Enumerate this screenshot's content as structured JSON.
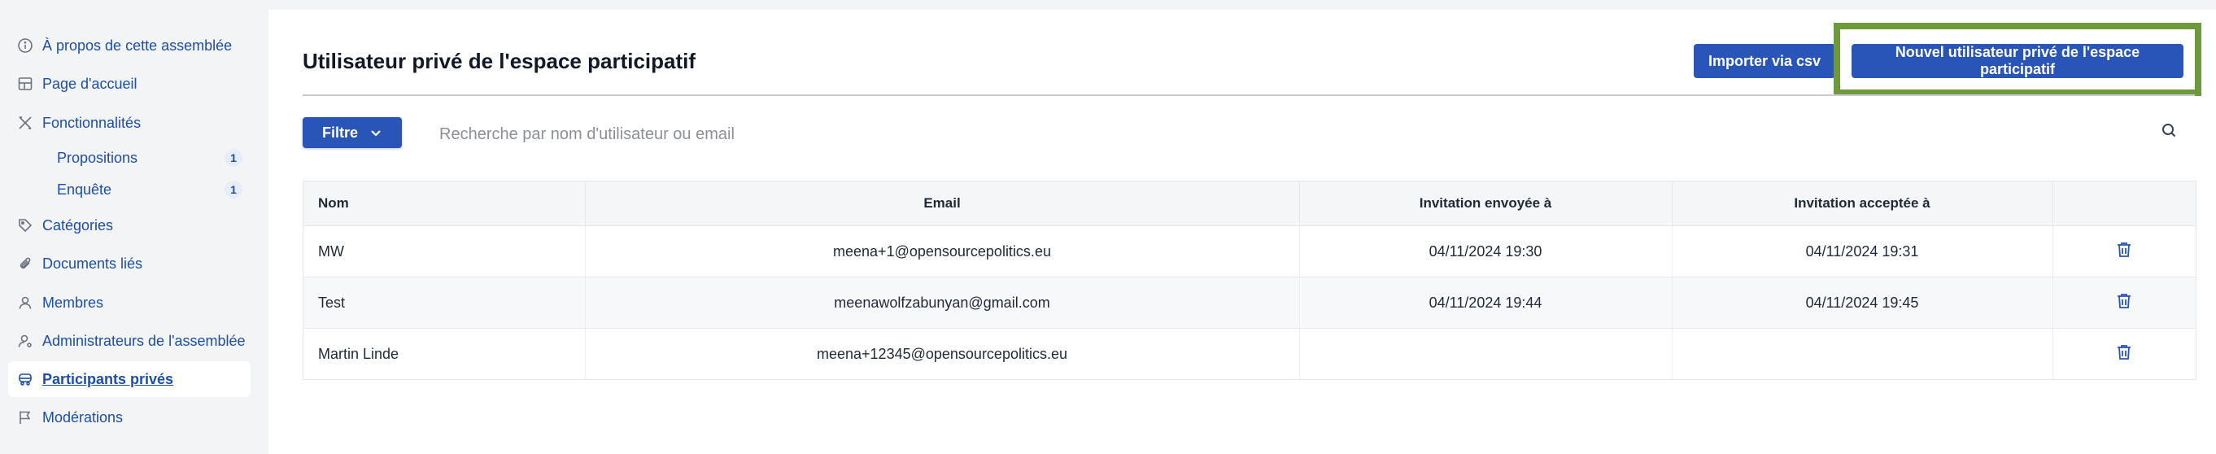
{
  "sidebar": {
    "items": [
      {
        "label": "À propos de cette assemblée",
        "icon": "info-icon"
      },
      {
        "label": "Page d'accueil",
        "icon": "layout-icon"
      },
      {
        "label": "Fonctionnalités",
        "icon": "tools-icon"
      },
      {
        "label": "Propositions",
        "badge": "1"
      },
      {
        "label": "Enquête",
        "badge": "1"
      },
      {
        "label": "Catégories",
        "icon": "tag-icon"
      },
      {
        "label": "Documents liés",
        "icon": "paperclip-icon"
      },
      {
        "label": "Membres",
        "icon": "user-icon"
      },
      {
        "label": "Administrateurs de l'assemblée",
        "icon": "user-settings-icon"
      },
      {
        "label": "Participants privés",
        "icon": "private-users-icon"
      },
      {
        "label": "Modérations",
        "icon": "flag-icon"
      }
    ]
  },
  "header": {
    "title": "Utilisateur privé de l'espace participatif",
    "import_label": "Importer via csv",
    "new_label": "Nouvel utilisateur privé de l'espace participatif"
  },
  "filters": {
    "filter_label": "Filtre",
    "search_placeholder": "Recherche par nom d'utilisateur ou email"
  },
  "table": {
    "columns": [
      "Nom",
      "Email",
      "Invitation envoyée à",
      "Invitation acceptée à",
      ""
    ],
    "rows": [
      {
        "name": "MW",
        "email": "meena+1@opensourcepolitics.eu",
        "sent": "04/11/2024 19:30",
        "accepted": "04/11/2024 19:31"
      },
      {
        "name": "Test",
        "email": "meenawolfzabunyan@gmail.com",
        "sent": "04/11/2024 19:44",
        "accepted": "04/11/2024 19:45"
      },
      {
        "name": "Martin Linde",
        "email": "meena+12345@opensourcepolitics.eu",
        "sent": "",
        "accepted": ""
      }
    ]
  },
  "colors": {
    "accent": "#2a55b8",
    "highlight": "#6e9a3d",
    "link": "#1d4ea8"
  }
}
